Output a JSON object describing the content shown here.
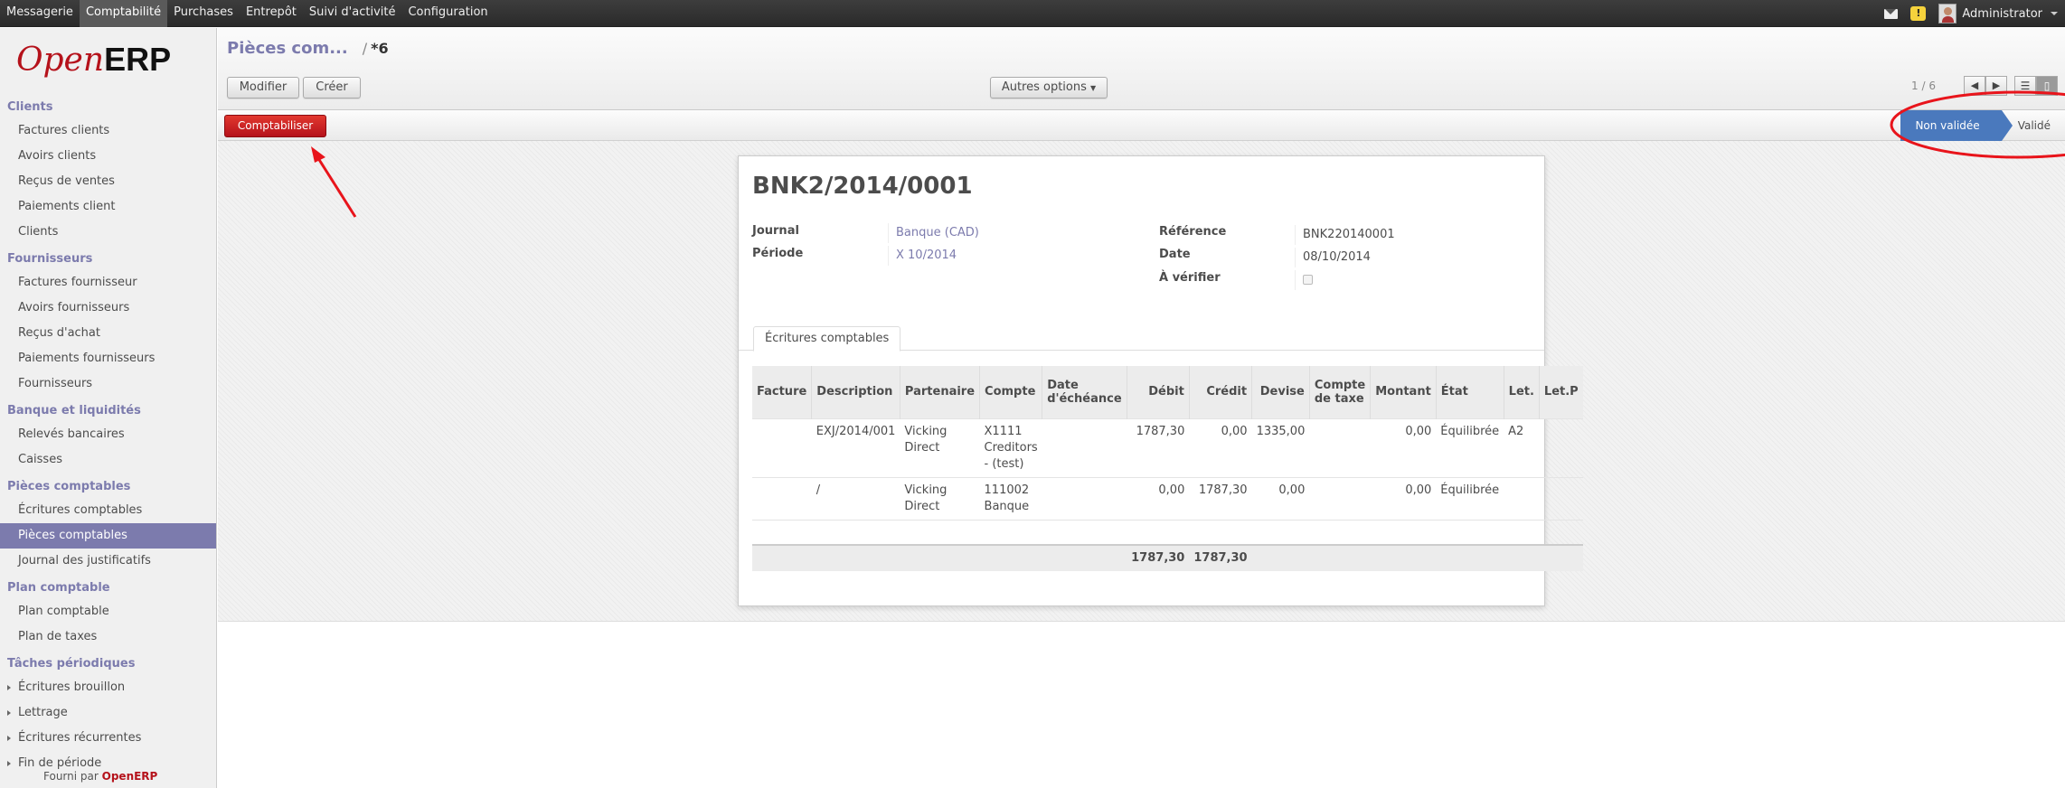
{
  "topbar": {
    "menu": [
      "Messagerie",
      "Comptabilité",
      "Purchases",
      "Entrepôt",
      "Suivi d'activité",
      "Configuration"
    ],
    "active_index": 1,
    "user": "Administrator"
  },
  "sidebar": {
    "logo_open": "Open",
    "logo_erp": "ERP",
    "sections": [
      {
        "title": "Clients",
        "items": [
          "Factures clients",
          "Avoirs clients",
          "Reçus de ventes",
          "Paiements client",
          "Clients"
        ]
      },
      {
        "title": "Fournisseurs",
        "items": [
          "Factures fournisseur",
          "Avoirs fournisseurs",
          "Reçus d'achat",
          "Paiements fournisseurs",
          "Fournisseurs"
        ]
      },
      {
        "title": "Banque et liquidités",
        "items": [
          "Relevés bancaires",
          "Caisses"
        ]
      },
      {
        "title": "Pièces comptables",
        "items": [
          "Écritures comptables",
          "Pièces comptables",
          "Journal des justificatifs"
        ]
      },
      {
        "title": "Plan comptable",
        "items": [
          "Plan comptable",
          "Plan de taxes"
        ]
      },
      {
        "title": "Tâches périodiques",
        "items": [
          "Écritures brouillon",
          "Lettrage",
          "Écritures récurrentes",
          "Fin de période"
        ]
      }
    ],
    "active_item": "Pièces comptables",
    "powered_prefix": "Fourni par",
    "powered_brand": "OpenERP"
  },
  "header": {
    "breadcrumb_link": "Pièces com...",
    "breadcrumb_sep": "/",
    "breadcrumb_current": "*6",
    "modify_label": "Modifier",
    "create_label": "Créer",
    "more_label": "Autres options",
    "pager": "1 / 6"
  },
  "statusbar": {
    "post_label": "Comptabiliser",
    "states": [
      "Non validée",
      "Validé"
    ]
  },
  "form": {
    "title": "BNK2/2014/0001",
    "journal_label": "Journal",
    "journal_value": "Banque (CAD)",
    "period_label": "Période",
    "period_value": "X 10/2014",
    "reference_label": "Référence",
    "reference_value": "BNK220140001",
    "date_label": "Date",
    "date_value": "08/10/2014",
    "to_check_label": "À vérifier",
    "tab_label": "Écritures comptables"
  },
  "table": {
    "headers": [
      "Facture",
      "Description",
      "Partenaire",
      "Compte",
      "Date d'échéance",
      "Débit",
      "Crédit",
      "Devise",
      "Compte de taxe",
      "Montant",
      "État",
      "Let.",
      "Let.P"
    ],
    "rows": [
      [
        "",
        "EXJ/2014/001",
        "Vicking Direct",
        "X1111 Creditors - (test)",
        "",
        "1787,30",
        "0,00",
        "1335,00",
        "",
        "0,00",
        "Équilibrée",
        "A2",
        ""
      ],
      [
        "",
        "/",
        "Vicking Direct",
        "111002 Banque",
        "",
        "0,00",
        "1787,30",
        "0,00",
        "",
        "0,00",
        "Équilibrée",
        "",
        ""
      ]
    ],
    "total_debit": "1787,30",
    "total_credit": "1787,30"
  },
  "colors": {
    "accent": "#7c7bad",
    "primary_red": "#b5121b",
    "state_blue": "#4a79bd",
    "annotation_red": "#e8141b"
  }
}
